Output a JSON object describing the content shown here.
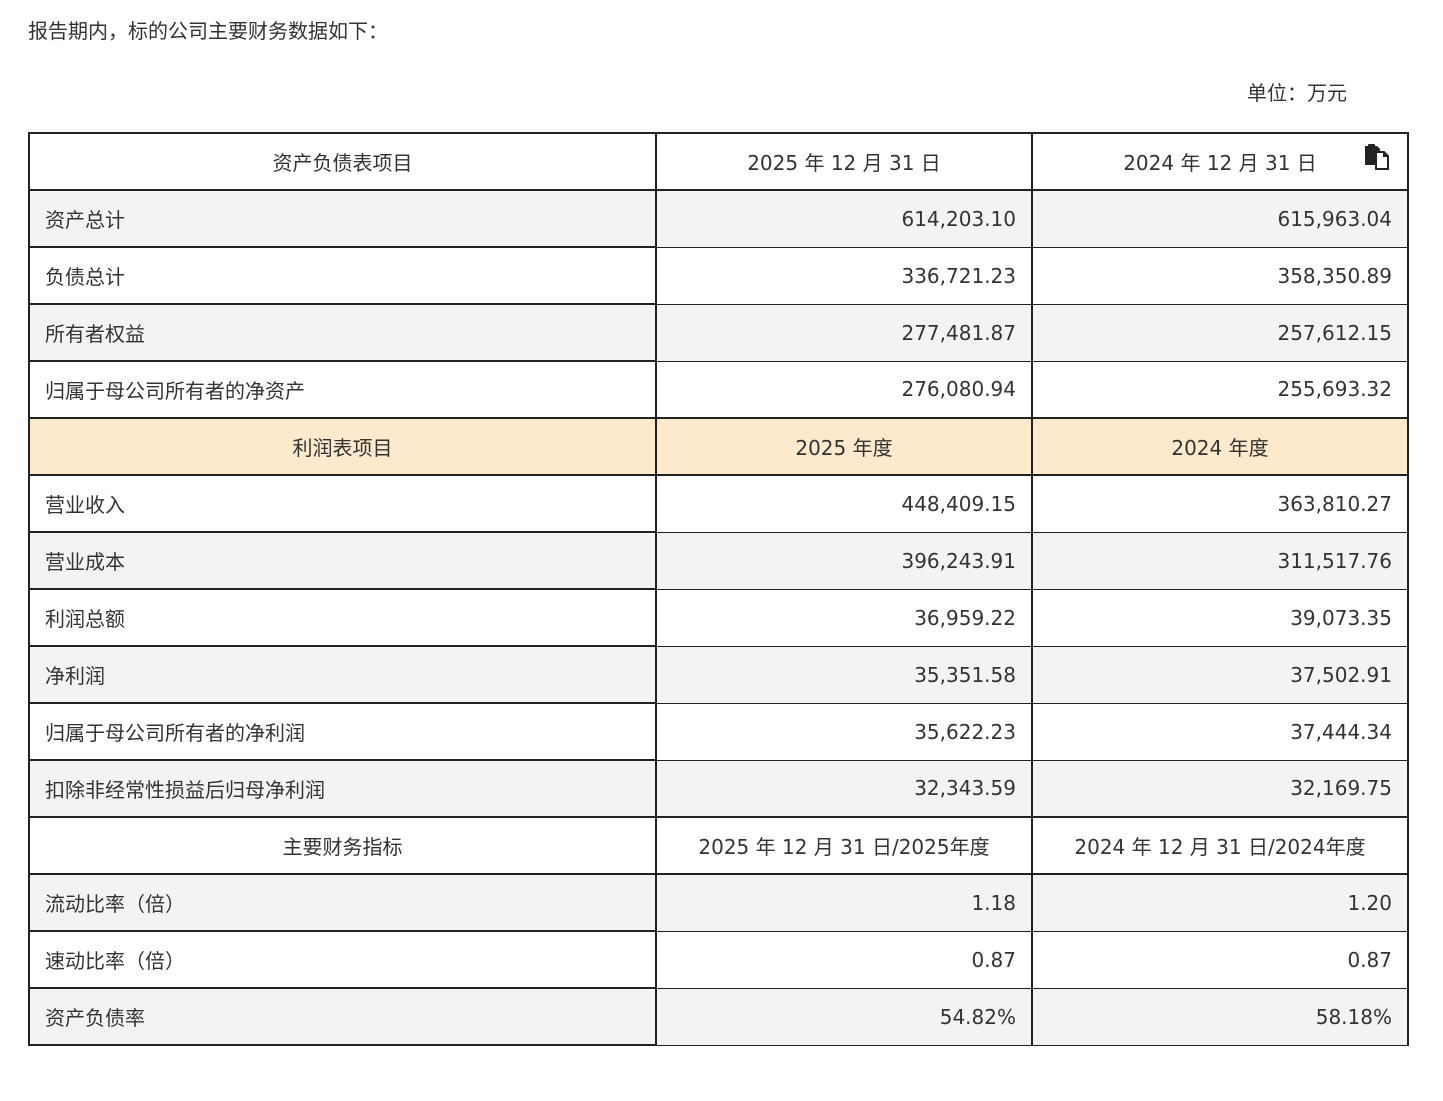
{
  "intro_text": "报告期内，标的公司主要财务数据如下：",
  "unit_text": "单位：万元",
  "copy_icon": "copy-icon",
  "colors": {
    "border": "#222222",
    "shaded_row": "#f3f3f3",
    "orange_header": "#fde9cc",
    "text": "#333333"
  },
  "balance_sheet": {
    "header": [
      "资产负债表项目",
      "2025 年 12 月 31 日",
      "2024 年 12 月 31 日"
    ],
    "rows": [
      [
        "资产总计",
        "614,203.10",
        "615,963.04"
      ],
      [
        "负债总计",
        "336,721.23",
        "358,350.89"
      ],
      [
        "所有者权益",
        "277,481.87",
        "257,612.15"
      ],
      [
        "归属于母公司所有者的净资产",
        "276,080.94",
        "255,693.32"
      ]
    ]
  },
  "income_statement": {
    "header": [
      "利润表项目",
      "2025 年度",
      "2024 年度"
    ],
    "rows": [
      [
        "营业收入",
        "448,409.15",
        "363,810.27"
      ],
      [
        "营业成本",
        "396,243.91",
        "311,517.76"
      ],
      [
        "利润总额",
        "36,959.22",
        "39,073.35"
      ],
      [
        "净利润",
        "35,351.58",
        "37,502.91"
      ],
      [
        "归属于母公司所有者的净利润",
        "35,622.23",
        "37,444.34"
      ],
      [
        "扣除非经常性损益后归母净利润",
        "32,343.59",
        "32,169.75"
      ]
    ]
  },
  "key_indicators": {
    "header": [
      "主要财务指标",
      "2025 年 12 月 31 日/2025年度",
      "2024 年 12 月 31 日/2024年度"
    ],
    "rows": [
      [
        "流动比率（倍）",
        "1.18",
        "1.20"
      ],
      [
        "速动比率（倍）",
        "0.87",
        "0.87"
      ],
      [
        "资产负债率",
        "54.82%",
        "58.18%"
      ]
    ]
  }
}
